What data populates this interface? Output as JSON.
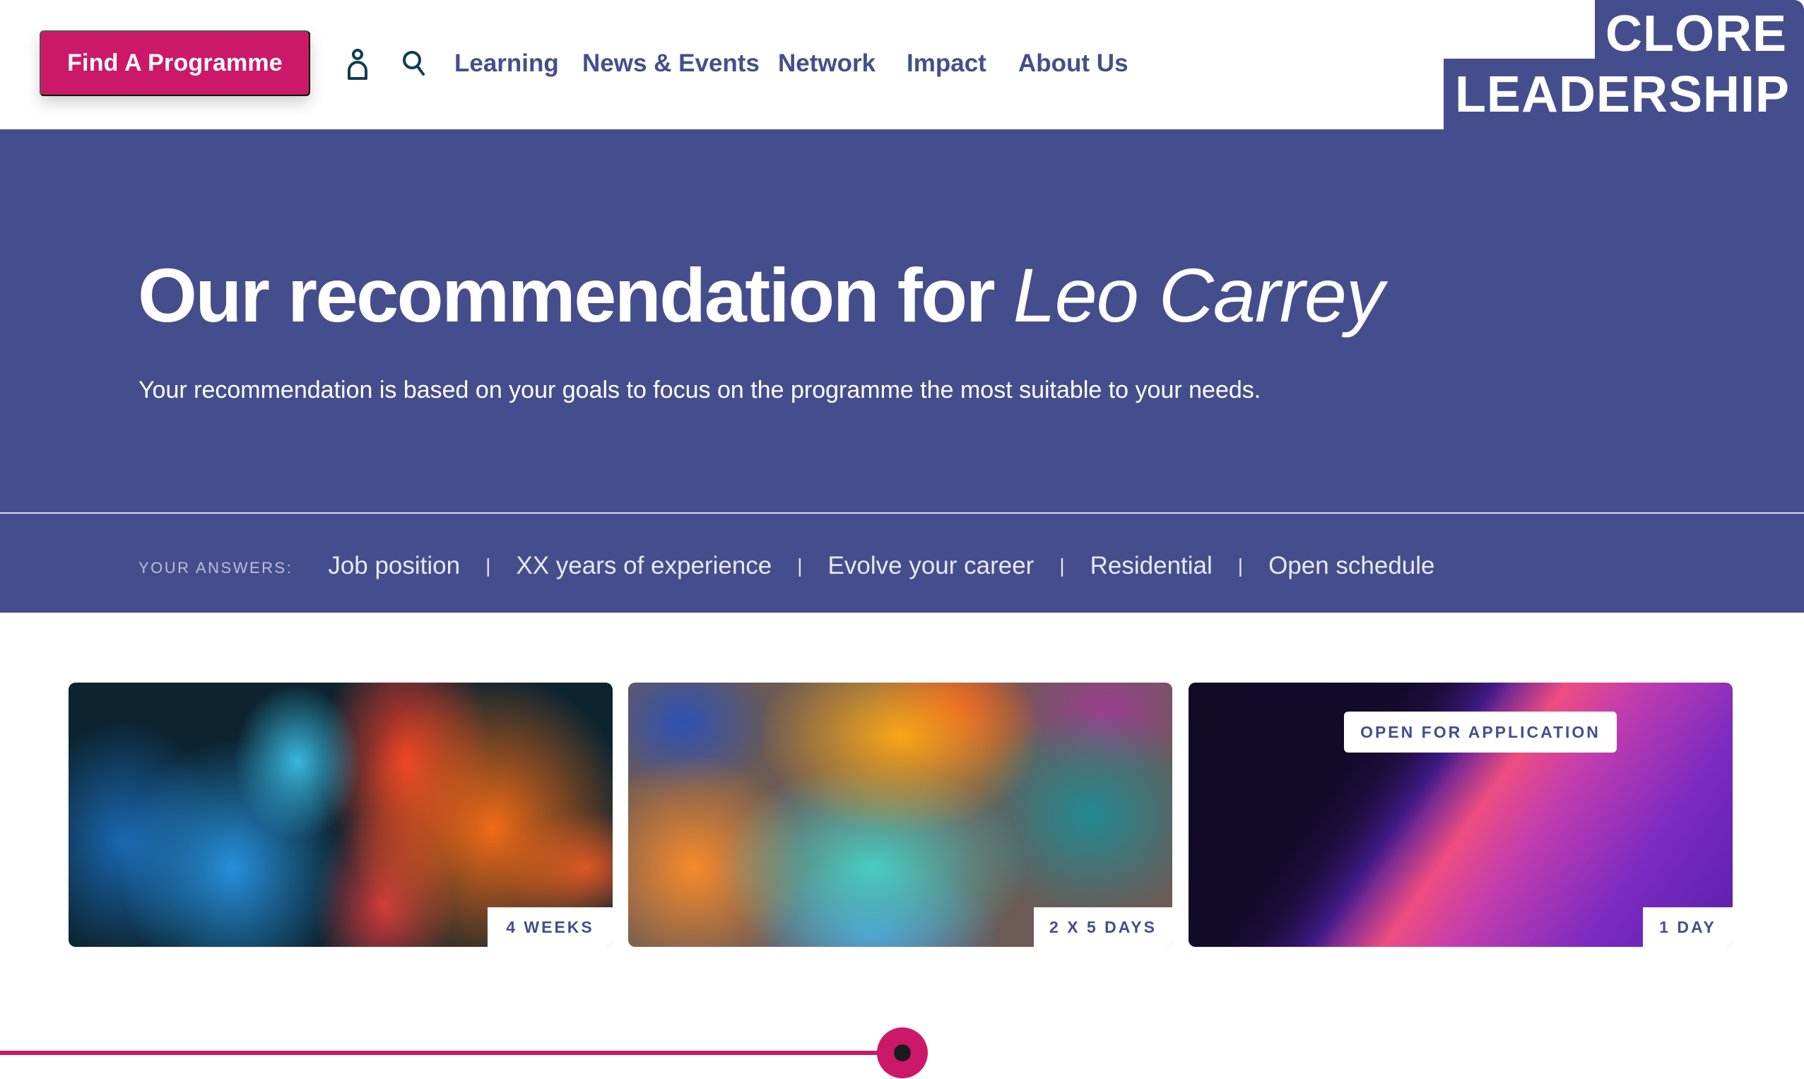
{
  "header": {
    "cta_label": "Find A Programme",
    "icons": [
      "user-icon",
      "search-icon"
    ],
    "nav": [
      "Learning",
      "News & Events",
      "Network",
      "Impact",
      "About Us"
    ],
    "logo_line1": "CLORE",
    "logo_line2": "LEADERSHIP"
  },
  "hero": {
    "title_prefix": "Our recommendation for",
    "title_name": "Leo Carrey",
    "subtitle": "Your recommendation is based on your goals to focus on the programme the most suitable to your needs.",
    "answers_label": "YOUR ANSWERS:",
    "answers": [
      "Job position",
      "XX years of experience",
      "Evolve your career",
      "Residential",
      "Open schedule"
    ],
    "separator": "|"
  },
  "cards": [
    {
      "duration": "4 WEEKS",
      "image": "ink-in-water-blue-orange"
    },
    {
      "duration": "2 X 5 DAYS",
      "image": "rainbow-bokeh"
    },
    {
      "duration": "1 DAY",
      "image": "purple-pink-abstract",
      "badge": "OPEN FOR APPLICATION"
    }
  ],
  "slider": {
    "progress": 0.5
  },
  "colors": {
    "brand": "#454e8c",
    "accent": "#cc1868",
    "text_on_brand": "#ffffff"
  }
}
